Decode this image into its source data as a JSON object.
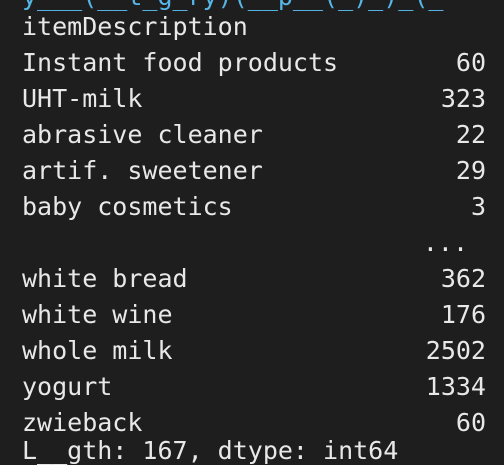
{
  "console": {
    "top_partial_text": "y___(__t_g_ry)(__p__(_)_)_(_",
    "column_header": "itemDescription",
    "rows_head": [
      {
        "name": "Instant food products",
        "count": "60"
      },
      {
        "name": "UHT-milk",
        "count": "323"
      },
      {
        "name": "abrasive cleaner",
        "count": "22"
      },
      {
        "name": "artif. sweetener",
        "count": "29"
      },
      {
        "name": "baby cosmetics",
        "count": "3"
      }
    ],
    "ellipsis": "...",
    "rows_tail": [
      {
        "name": "white bread",
        "count": "362"
      },
      {
        "name": "white wine",
        "count": "176"
      },
      {
        "name": "whole milk",
        "count": "2502"
      },
      {
        "name": "yogurt",
        "count": "1334"
      },
      {
        "name": "zwieback",
        "count": "60"
      }
    ],
    "bottom_partial_text": "L__gth: 167, dtype: int64"
  }
}
